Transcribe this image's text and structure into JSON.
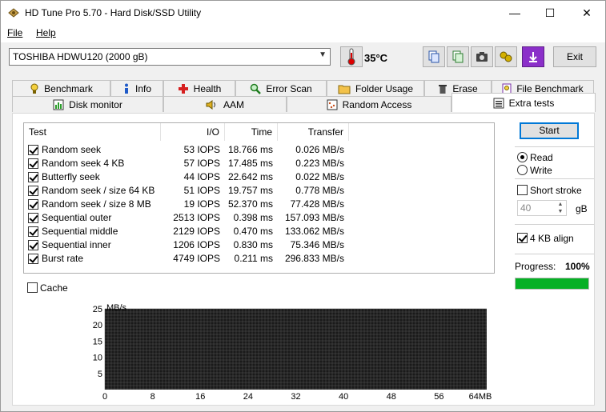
{
  "window": {
    "title": "HD Tune Pro 5.70 - Hard Disk/SSD Utility",
    "minimize": "—",
    "maximize": "☐",
    "close": "✕"
  },
  "menu": [
    {
      "label": "File",
      "accel": "F"
    },
    {
      "label": "Help",
      "accel": "H"
    }
  ],
  "toolbar": {
    "drive": "TOSHIBA HDWU120 (2000 gB)",
    "temperature": "35°C",
    "exit_label": "Exit"
  },
  "tabs_row1": [
    {
      "label": "Benchmark",
      "icon": "benchmark-icon"
    },
    {
      "label": "Info",
      "icon": "info-icon"
    },
    {
      "label": "Health",
      "icon": "health-icon"
    },
    {
      "label": "Error Scan",
      "icon": "error-scan-icon"
    },
    {
      "label": "Folder Usage",
      "icon": "folder-icon"
    },
    {
      "label": "Erase",
      "icon": "erase-icon"
    },
    {
      "label": "File Benchmark",
      "icon": "file-benchmark-icon"
    }
  ],
  "tabs_row2": [
    {
      "label": "Disk monitor",
      "icon": "disk-monitor-icon"
    },
    {
      "label": "AAM",
      "icon": "speaker-icon"
    },
    {
      "label": "Random Access",
      "icon": "random-access-icon"
    },
    {
      "label": "Extra tests",
      "icon": "extra-tests-icon",
      "active": true
    }
  ],
  "table": {
    "headers": [
      "Test",
      "I/O",
      "Time",
      "Transfer"
    ],
    "rows": [
      {
        "test": "Random seek",
        "io": "53 IOPS",
        "time": "18.766 ms",
        "transfer": "0.026 MB/s",
        "checked": true
      },
      {
        "test": "Random seek 4 KB",
        "io": "57 IOPS",
        "time": "17.485 ms",
        "transfer": "0.223 MB/s",
        "checked": true
      },
      {
        "test": "Butterfly seek",
        "io": "44 IOPS",
        "time": "22.642 ms",
        "transfer": "0.022 MB/s",
        "checked": true
      },
      {
        "test": "Random seek / size 64 KB",
        "io": "51 IOPS",
        "time": "19.757 ms",
        "transfer": "0.778 MB/s",
        "checked": true
      },
      {
        "test": "Random seek / size 8 MB",
        "io": "19 IOPS",
        "time": "52.370 ms",
        "transfer": "77.428 MB/s",
        "checked": true
      },
      {
        "test": "Sequential outer",
        "io": "2513 IOPS",
        "time": "0.398 ms",
        "transfer": "157.093 MB/s",
        "checked": true
      },
      {
        "test": "Sequential middle",
        "io": "2129 IOPS",
        "time": "0.470 ms",
        "transfer": "133.062 MB/s",
        "checked": true
      },
      {
        "test": "Sequential inner",
        "io": "1206 IOPS",
        "time": "0.830 ms",
        "transfer": "75.346 MB/s",
        "checked": true
      },
      {
        "test": "Burst rate",
        "io": "4749 IOPS",
        "time": "0.211 ms",
        "transfer": "296.833 MB/s",
        "checked": true
      }
    ]
  },
  "cache": {
    "label": "Cache",
    "checked": false
  },
  "side": {
    "start_label": "Start",
    "read_label": "Read",
    "write_label": "Write",
    "mode": "read",
    "short_stroke_label": "Short stroke",
    "short_stroke_checked": false,
    "stroke_value": "40",
    "stroke_unit": "gB",
    "align_label": "4 KB align",
    "align_checked": true,
    "progress_label": "Progress:",
    "progress_value": "100%",
    "progress_fraction": 1.0,
    "progress_color": "#06b025"
  },
  "chart_data": {
    "type": "line",
    "ylabel": "MB/s",
    "ylim": [
      0,
      25
    ],
    "yticks": [
      "25",
      "20",
      "15",
      "10",
      "5"
    ],
    "xlim": [
      0,
      64
    ],
    "xticks": [
      "0",
      "8",
      "16",
      "24",
      "32",
      "40",
      "48",
      "56",
      "64MB"
    ],
    "series": [],
    "grid": true,
    "background": "#1a1a1a",
    "grid_color": "#555555"
  }
}
